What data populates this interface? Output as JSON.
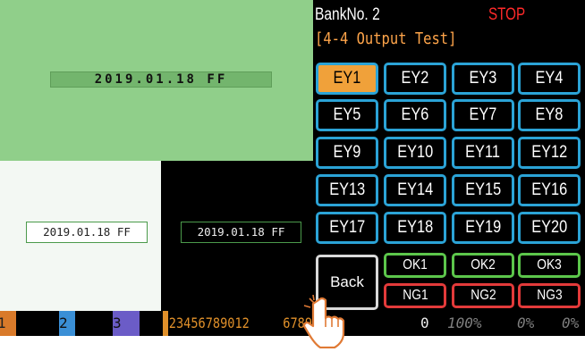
{
  "previews": {
    "top_date": "2019.01.18 FF",
    "bottom_left_date": "2019.01.18 FF",
    "bottom_right_date": "2019.01.18 FF"
  },
  "header": {
    "bank_label": "BankNo. 2",
    "status": "STOP",
    "title": "[4-4 Output Test]"
  },
  "buttons": {
    "ey": [
      "EY1",
      "EY2",
      "EY3",
      "EY4",
      "EY5",
      "EY6",
      "EY7",
      "EY8",
      "EY9",
      "EY10",
      "EY11",
      "EY12",
      "EY13",
      "EY14",
      "EY15",
      "EY16",
      "EY17",
      "EY18",
      "EY19",
      "EY20"
    ],
    "active": "EY1",
    "back": "Back",
    "ok": [
      "OK1",
      "OK2",
      "OK3"
    ],
    "ng": [
      "NG1",
      "NG2",
      "NG3"
    ]
  },
  "status_bar": {
    "seg1": "1",
    "seg2": "2",
    "seg3": "3",
    "counter": "23456789012",
    "counter_tail": "67890",
    "zero": "0",
    "pct1": "100%",
    "pct2": "0%",
    "pct3": "0%"
  },
  "colors": {
    "accent_orange": "#f0a13a",
    "button_border_blue": "#2ba3d6",
    "ok_green": "#5cc64b",
    "ng_red": "#e33a3a",
    "stop_red": "#ff2a2a",
    "preview_green": "#90cf8a"
  },
  "icons": {
    "touch": "hand-pointer-icon"
  }
}
